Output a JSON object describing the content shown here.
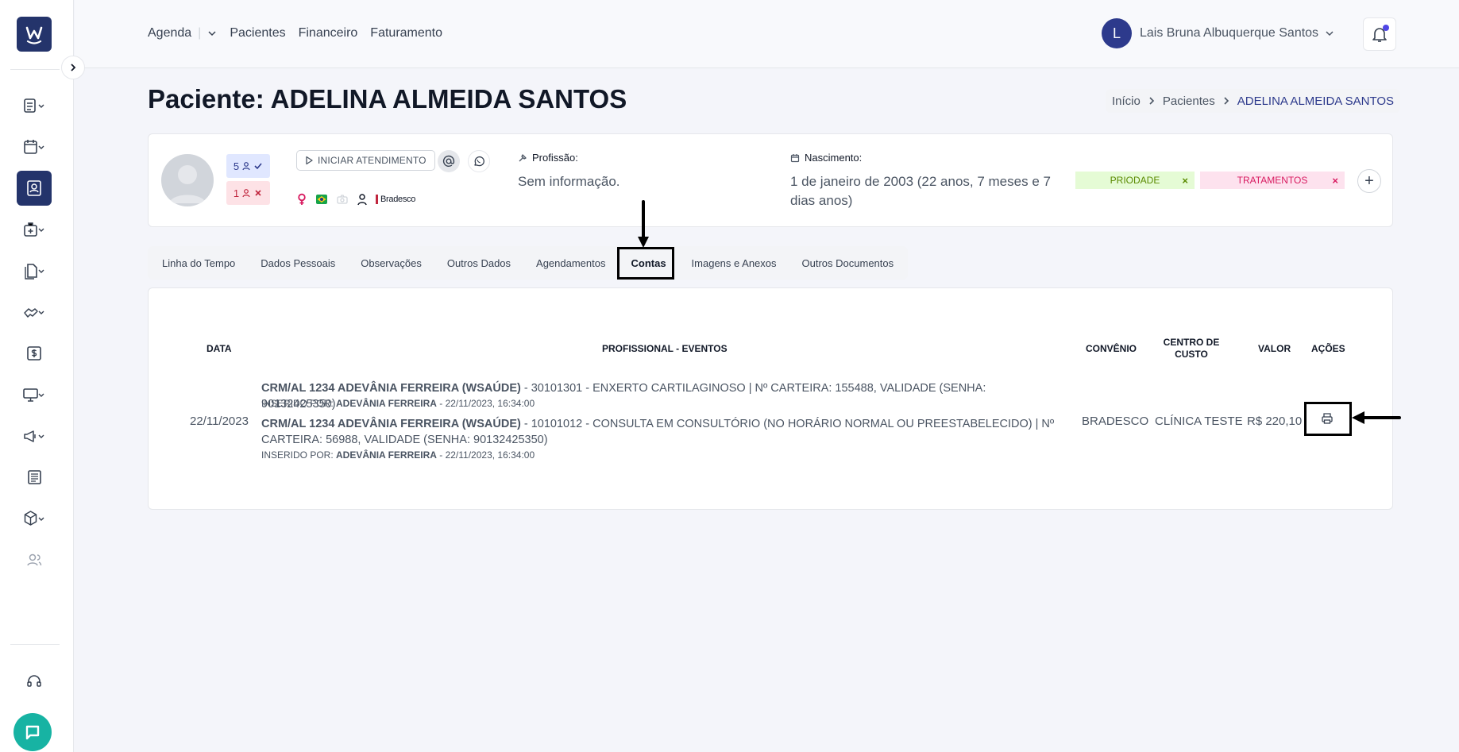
{
  "nav": {
    "items": [
      "Agenda",
      "Pacientes",
      "Financeiro",
      "Faturamento"
    ]
  },
  "user": {
    "initial": "L",
    "name": "Lais Bruna Albuquerque Santos"
  },
  "page": {
    "title": "Paciente: ADELINA ALMEIDA SANTOS"
  },
  "breadcrumb": {
    "items": [
      "Início",
      "Pacientes",
      "ADELINA ALMEIDA SANTOS"
    ]
  },
  "patient": {
    "badge_present": "5",
    "badge_absent": "1",
    "start_button": "INICIAR ATENDIMENTO",
    "insurance_logo_text": "Bradesco",
    "profession_label": "Profissão:",
    "profession_value": "Sem informação.",
    "birth_label": "Nascimento:",
    "birth_value_line1": "1 de janeiro de 2003 (22 anos, 7 meses e 7",
    "birth_value_line2": "dias anos)",
    "tags": [
      {
        "label": "PRIODADE",
        "color": "#5a8a00",
        "bg": "#e5fbd5"
      },
      {
        "label": "TRATAMENTOS",
        "color": "#d81b60",
        "bg": "#fde2ee"
      }
    ],
    "tag_remove": "×",
    "add": "+"
  },
  "tabs": [
    "Linha do Tempo",
    "Dados Pessoais",
    "Observações",
    "Outros Dados",
    "Agendamentos",
    "Contas",
    "Imagens e Anexos",
    "Outros Documentos"
  ],
  "accounts": {
    "headers": {
      "date": "DATA",
      "events": "PROFISSIONAL - EVENTOS",
      "insurance": "CONVÊNIO",
      "cost_center_1": "CENTRO DE",
      "cost_center_2": "CUSTO",
      "value": "VALOR",
      "actions": "AÇÕES"
    },
    "row": {
      "date": "22/11/2023",
      "insurance": "BRADESCO",
      "cost_center": "CLÍNICA TESTE",
      "value": "R$ 220,10",
      "events": [
        {
          "professional": "CRM/AL 1234 ADEVÂNIA FERREIRA (WSAÚDE)",
          "line1": " - 30101301 - ENXERTO CARTILAGINOSO | Nº CARTEIRA: 155488, VALIDADE (SENHA: 90132425350)",
          "line2": "",
          "inserted_label": "INSERIDO POR: ",
          "inserted_by": "ADEVÂNIA FERREIRA",
          "inserted_at": " - 22/11/2023, 16:34:00"
        },
        {
          "professional": "CRM/AL 1234 ADEVÂNIA FERREIRA (WSAÚDE)",
          "line1": " - 10101012 - CONSULTA EM CONSULTÓRIO (NO HORÁRIO NORMAL OU PREESTABELECIDO) | Nº",
          "line2": "CARTEIRA: 56988, VALIDADE (SENHA: 90132425350)",
          "inserted_label": "INSERIDO POR: ",
          "inserted_by": "ADEVÂNIA FERREIRA",
          "inserted_at": " - 22/11/2023, 16:34:00"
        }
      ]
    }
  },
  "colors": {
    "brand": "#24346b",
    "accent": "#2d3a8c",
    "chat": "#17b3a3"
  }
}
